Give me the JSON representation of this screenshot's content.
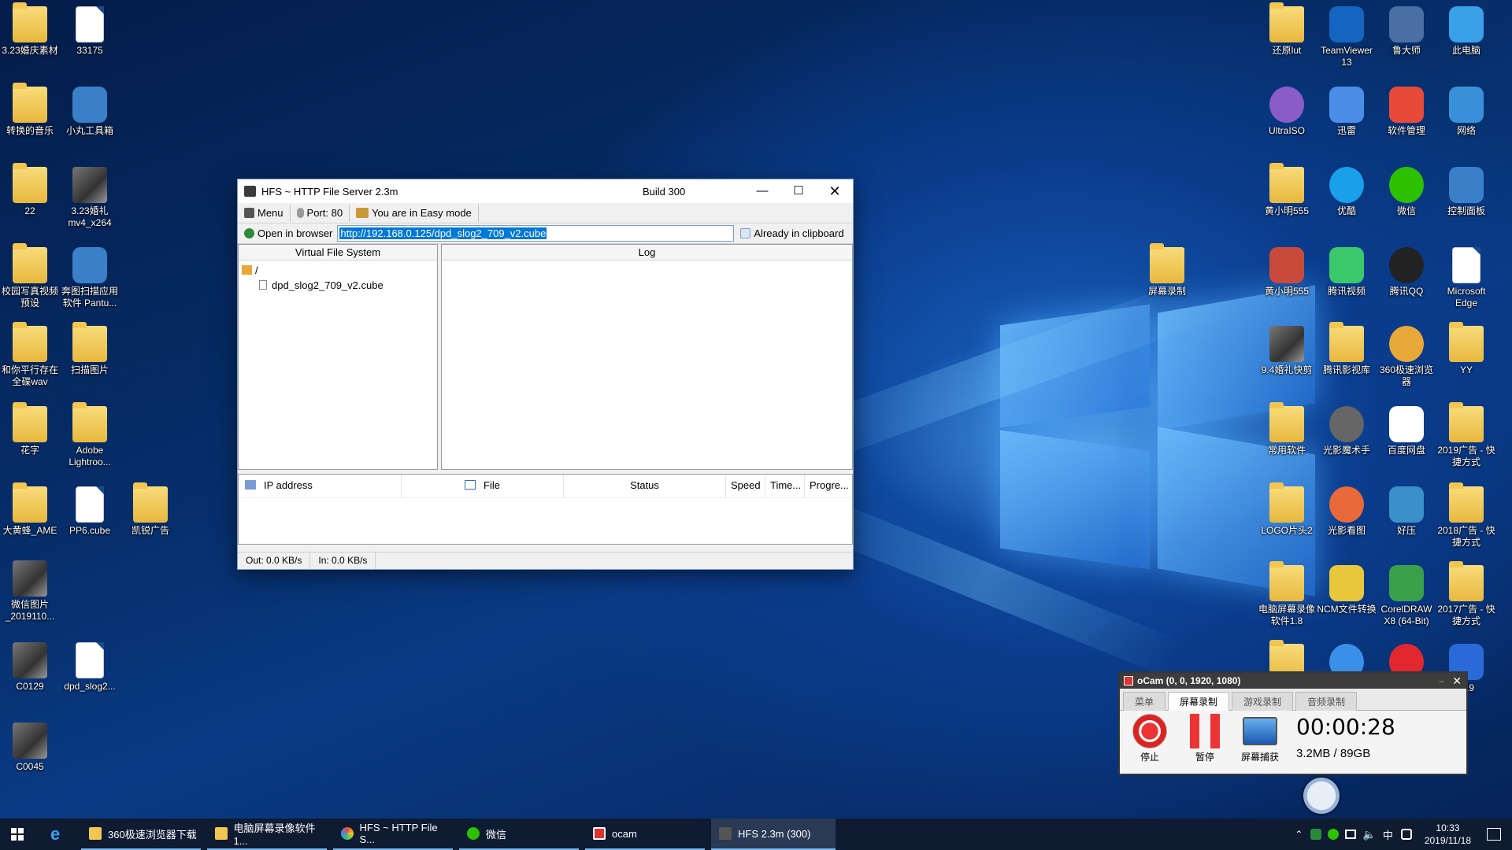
{
  "desktop": {
    "left_icons": [
      {
        "label": "3.23婚庆素材",
        "kind": "folder",
        "icon": "folder-icon"
      },
      {
        "label": "33175",
        "kind": "doc",
        "icon": "image-file-icon"
      },
      {
        "label": "转换的音乐",
        "kind": "folder",
        "icon": "folder-icon"
      },
      {
        "label": "小丸工具箱",
        "kind": "app",
        "icon": "xiaowan-toolbox-icon"
      },
      {
        "label": "22",
        "kind": "folder",
        "icon": "folder-icon"
      },
      {
        "label": "3.23婚礼mv4_x264",
        "kind": "photo",
        "icon": "video-file-icon"
      },
      {
        "label": "校园写真视频预设",
        "kind": "folder",
        "icon": "folder-icon"
      },
      {
        "label": "奔图扫描应用软件 Pantu...",
        "kind": "app",
        "icon": "scanner-app-icon"
      },
      {
        "label": "和你平行存在全碟wav",
        "kind": "folder",
        "icon": "folder-icon"
      },
      {
        "label": "扫描图片",
        "kind": "folder",
        "icon": "folder-icon"
      },
      {
        "label": "花字",
        "kind": "folder",
        "icon": "folder-icon"
      },
      {
        "label": "Adobe Lightroo...",
        "kind": "folder",
        "icon": "lightroom-icon"
      },
      {
        "label": "大黄蜂_AME",
        "kind": "folder",
        "icon": "folder-icon"
      },
      {
        "label": "PP6.cube",
        "kind": "doc",
        "icon": "file-icon"
      },
      {
        "label": "凯锐广告",
        "kind": "folder",
        "icon": "folder-icon"
      },
      {
        "label": "微信图片_2019110...",
        "kind": "photo",
        "icon": "image-file-icon"
      },
      {
        "label": "C0129",
        "kind": "photo",
        "icon": "video-file-icon"
      },
      {
        "label": "dpd_slog2...",
        "kind": "doc",
        "icon": "file-icon"
      },
      {
        "label": "C0045",
        "kind": "photo",
        "icon": "video-file-icon"
      }
    ],
    "right_icons": [
      {
        "label": "还原lut",
        "kind": "folder",
        "icon": "folder-icon"
      },
      {
        "label": "TeamViewer 13",
        "kind": "app",
        "icon": "teamviewer-icon",
        "color": "#1565c0"
      },
      {
        "label": "鲁大师",
        "kind": "app",
        "icon": "ludashi-icon",
        "color": "#4a6fa5"
      },
      {
        "label": "此电脑",
        "kind": "app",
        "icon": "computer-icon",
        "color": "#3aa0e8"
      },
      {
        "label": "UltraISO",
        "kind": "app",
        "icon": "ultraiso-icon",
        "color": "#8a5cc8"
      },
      {
        "label": "迅雷",
        "kind": "app",
        "icon": "xunlei-icon",
        "color": "#4a8ee8"
      },
      {
        "label": "软件管理",
        "kind": "app",
        "icon": "software-manager-icon",
        "color": "#e84a3a"
      },
      {
        "label": "网络",
        "kind": "app",
        "icon": "network-icon",
        "color": "#3a90d8"
      },
      {
        "label": "黄小明555",
        "kind": "folder",
        "icon": "folder-icon"
      },
      {
        "label": "优酷",
        "kind": "app",
        "icon": "youku-icon",
        "color": "#1aa0e8"
      },
      {
        "label": "微信",
        "kind": "app",
        "icon": "wechat-icon",
        "color": "#2dc100"
      },
      {
        "label": "控制面板",
        "kind": "app",
        "icon": "control-panel-icon",
        "color": "#3a80c8"
      },
      {
        "label": "屏幕录制",
        "kind": "folder",
        "icon": "folder-icon"
      },
      {
        "label": "黄小明555",
        "kind": "app",
        "icon": "archive-icon",
        "color": "#c84a3a"
      },
      {
        "label": "腾讯视频",
        "kind": "app",
        "icon": "tencent-video-icon",
        "color": "#3ac86a"
      },
      {
        "label": "腾讯QQ",
        "kind": "app",
        "icon": "qq-icon",
        "color": "#222222"
      },
      {
        "label": "Microsoft Edge",
        "kind": "doc",
        "icon": "edge-file-icon"
      },
      {
        "label": "9.4婚礼快剪",
        "kind": "photo",
        "icon": "video-file-icon"
      },
      {
        "label": "腾讯影视库",
        "kind": "folder",
        "icon": "folder-icon"
      },
      {
        "label": "360极速浏览器",
        "kind": "app",
        "icon": "browser-360-icon",
        "color": "#e8a83a"
      },
      {
        "label": "YY",
        "kind": "folder",
        "icon": "folder-icon"
      },
      {
        "label": "常用软件",
        "kind": "folder",
        "icon": "folder-icon"
      },
      {
        "label": "光影魔术手",
        "kind": "app",
        "icon": "nevercam-icon",
        "color": "#666666"
      },
      {
        "label": "百度网盘",
        "kind": "app",
        "icon": "baidu-netdisk-icon",
        "color": "#ffffff"
      },
      {
        "label": "2019广告 - 快捷方式",
        "kind": "folder",
        "icon": "folder-icon"
      },
      {
        "label": "LOGO片头2",
        "kind": "folder",
        "icon": "folder-icon"
      },
      {
        "label": "光影看图",
        "kind": "app",
        "icon": "image-viewer-icon",
        "color": "#e86a3a"
      },
      {
        "label": "好压",
        "kind": "app",
        "icon": "haozip-icon",
        "color": "#3a90c8"
      },
      {
        "label": "2018广告 - 快捷方式",
        "kind": "folder",
        "icon": "folder-icon"
      },
      {
        "label": "电脑屏幕录像软件1.8",
        "kind": "folder",
        "icon": "folder-icon"
      },
      {
        "label": "NCM文件转换",
        "kind": "app",
        "icon": "ncm-converter-icon",
        "color": "#e8c83a"
      },
      {
        "label": "CorelDRAW X8 (64-Bit)",
        "kind": "app",
        "icon": "coreldraw-icon",
        "color": "#3aa04a"
      },
      {
        "label": "2017广告 - 快捷方式",
        "kind": "folder",
        "icon": "folder-icon"
      },
      {
        "label": "",
        "kind": "folder",
        "icon": "folder-icon"
      },
      {
        "label": "",
        "kind": "app",
        "icon": "cloud-app-icon",
        "color": "#3a90e8"
      },
      {
        "label": "",
        "kind": "app",
        "icon": "netease-music-icon",
        "color": "#e0282e"
      },
      {
        "label": "019",
        "kind": "app",
        "icon": "wps-icon",
        "color": "#2a6ad8"
      }
    ]
  },
  "hfs": {
    "title": "HFS ~ HTTP File Server 2.3m",
    "build": "Build 300",
    "toolbar": {
      "menu": "Menu",
      "port": "Port: 80",
      "mode": "You are in Easy mode"
    },
    "open_in_browser": "Open in browser",
    "url": "http://192.168.0.125/dpd_slog2_709_v2.cube",
    "clipboard": "Already in clipboard",
    "vfs_header": "Virtual File System",
    "log_header": "Log",
    "tree_root": "/",
    "tree_file": "dpd_slog2_709_v2.cube",
    "columns": {
      "ip": "IP address",
      "file": "File",
      "status": "Status",
      "speed": "Speed",
      "time": "Time...",
      "progress": "Progre..."
    },
    "status_out": "Out: 0.0 KB/s",
    "status_in": "In: 0.0 KB/s"
  },
  "ocam": {
    "title": "oCam (0, 0, 1920, 1080)",
    "tabs": [
      "菜单",
      "屏幕录制",
      "游戏录制",
      "音频录制"
    ],
    "active_tab": "屏幕录制",
    "stop": "停止",
    "pause": "暂停",
    "capture": "屏幕捕获",
    "timer": "00:00:28",
    "size": "3.2MB / 89GB"
  },
  "taskbar": {
    "items": [
      {
        "label": "360极速浏览器下载",
        "icon": "folder-icon"
      },
      {
        "label": "电脑屏幕录像软件1...",
        "icon": "folder-icon"
      },
      {
        "label": "HFS ~ HTTP File S...",
        "icon": "browser-360-icon"
      },
      {
        "label": "微信",
        "icon": "wechat-icon"
      },
      {
        "label": "ocam",
        "icon": "ocam-icon"
      },
      {
        "label": "HFS 2.3m (300)",
        "icon": "hfs-icon"
      }
    ],
    "ime": "中",
    "time": "10:33",
    "date": "2019/11/18"
  }
}
